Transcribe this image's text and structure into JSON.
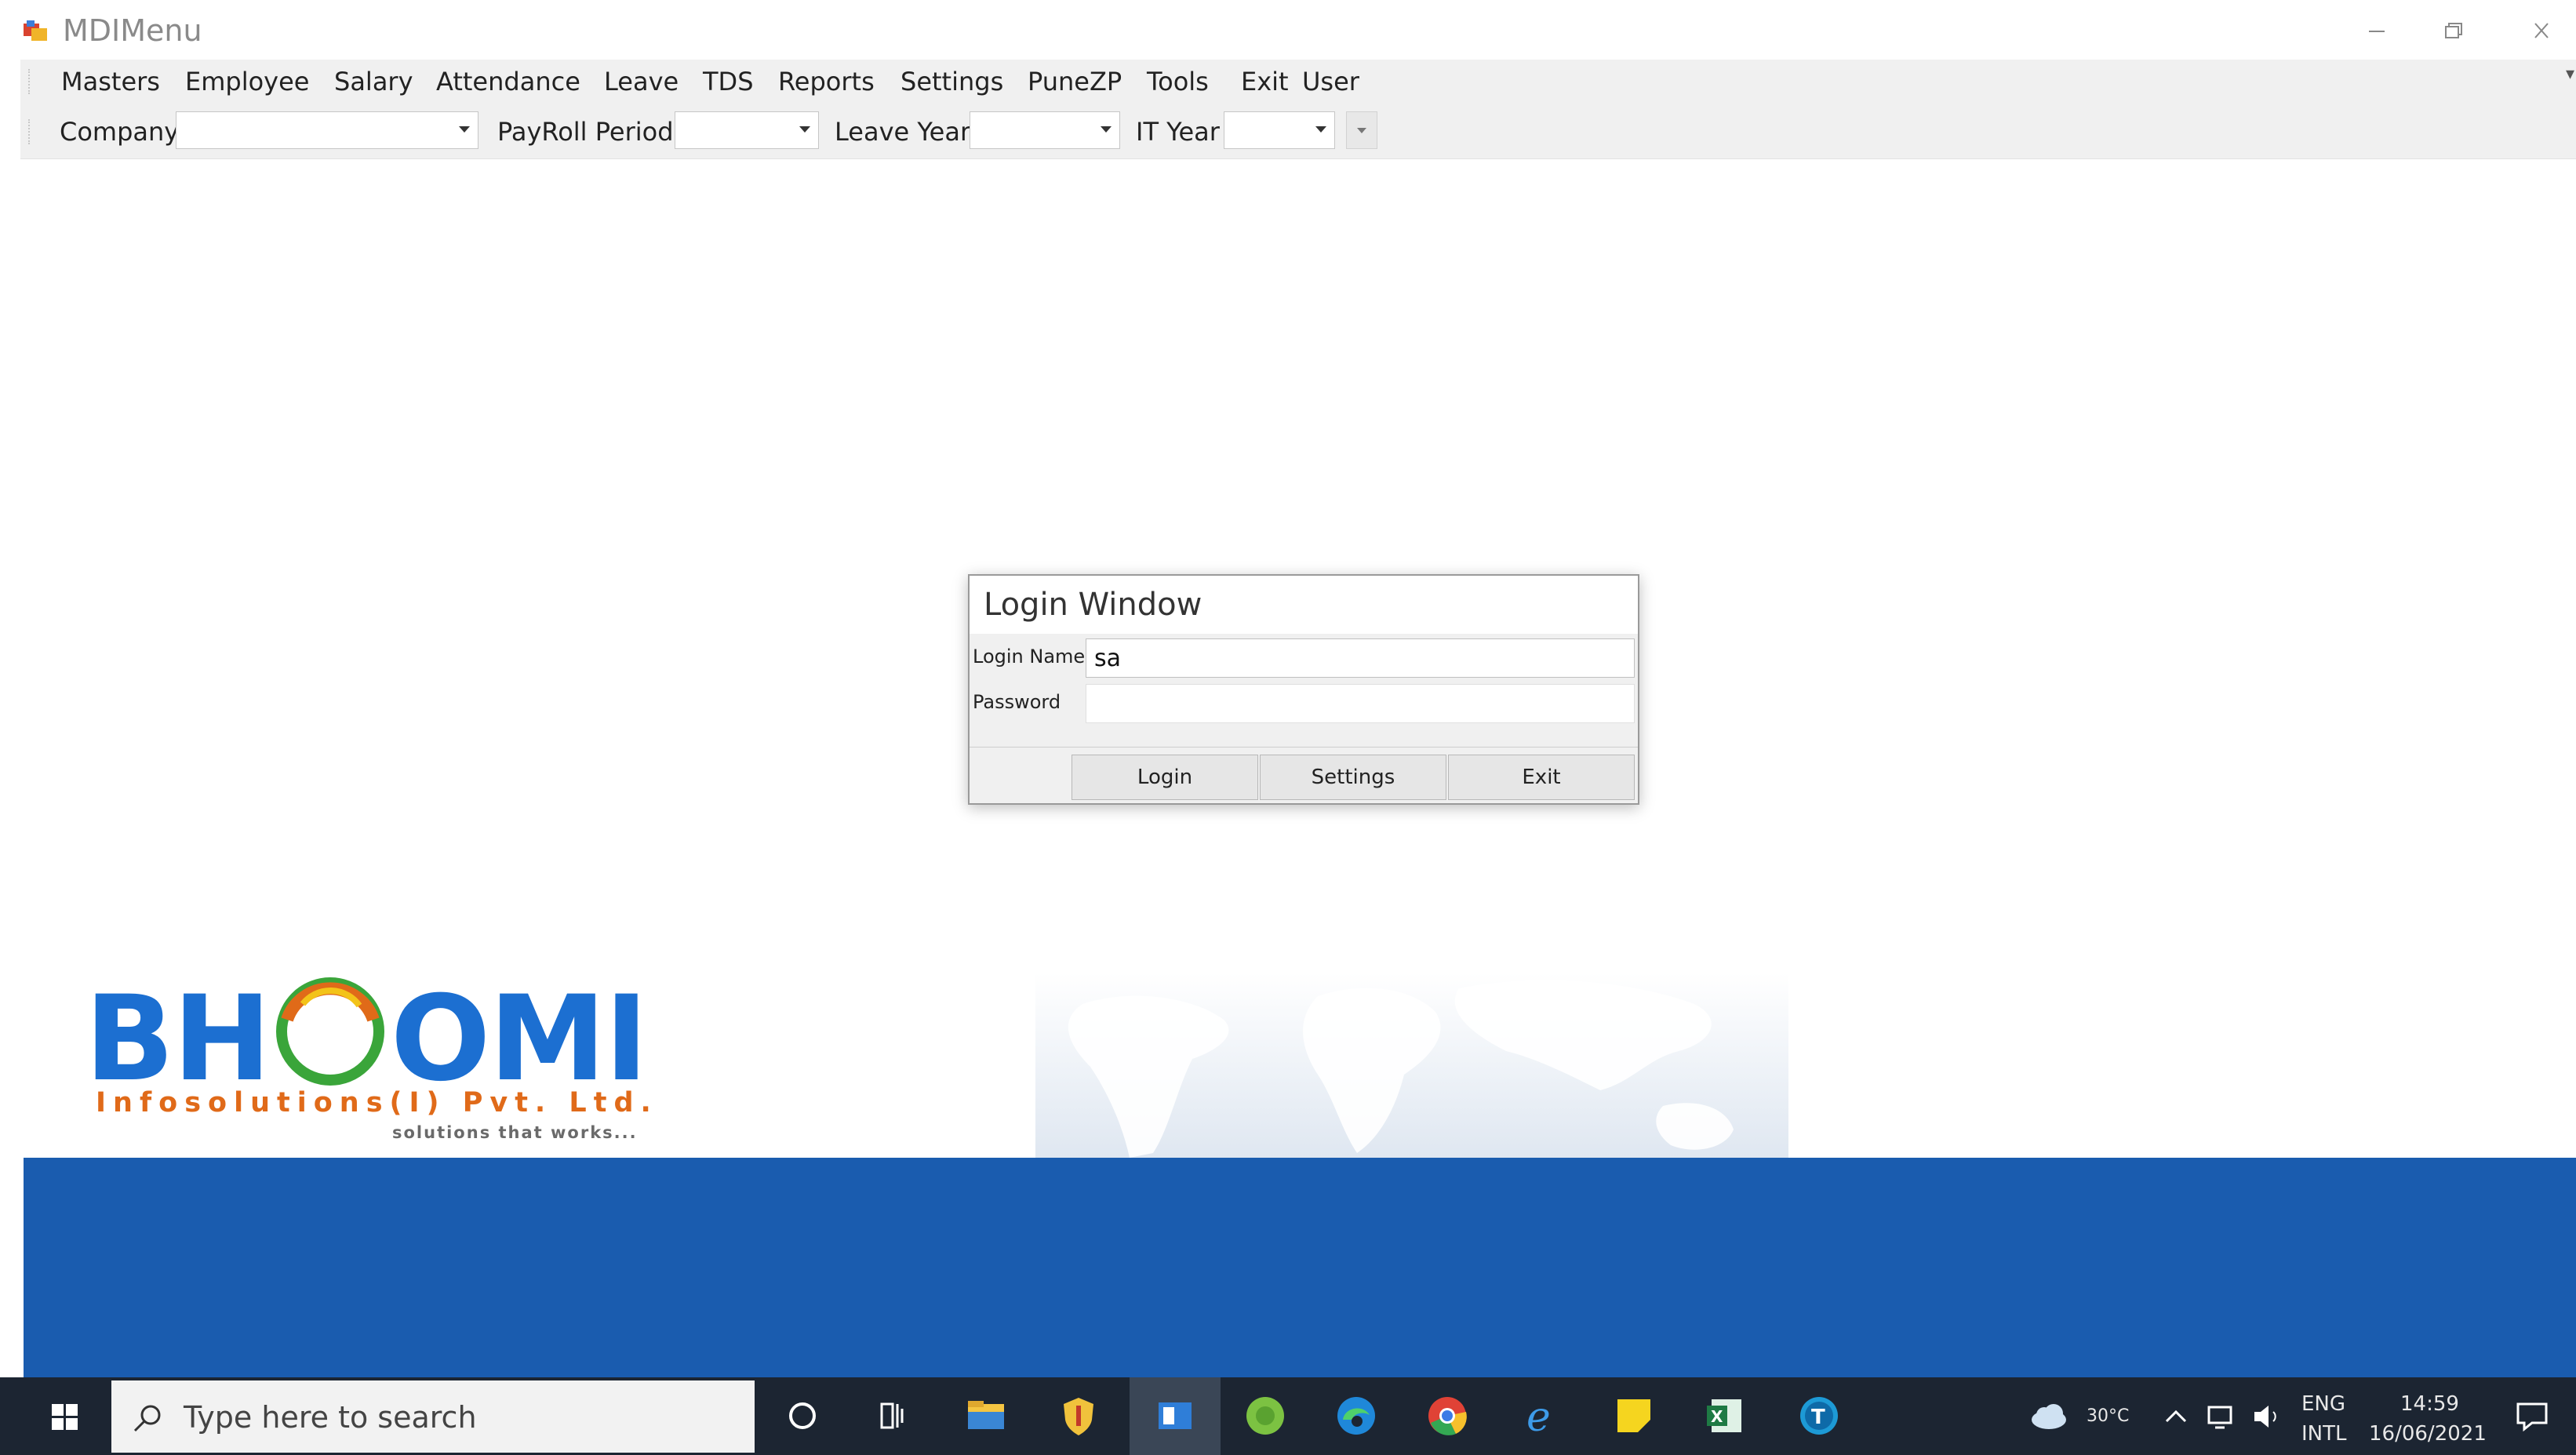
{
  "window": {
    "title": "MDIMenu"
  },
  "menu": {
    "items": [
      "Masters",
      "Employee",
      "Salary",
      "Attendance",
      "Leave",
      "TDS",
      "Reports",
      "Settings",
      "PuneZP",
      "Tools",
      "Exit",
      "User"
    ]
  },
  "toolbar": {
    "company_label": "Company",
    "company_value": "",
    "payroll_label": "PayRoll Period",
    "payroll_value": "",
    "leave_label": "Leave Year",
    "leave_value": "",
    "it_label": "IT Year",
    "it_value": ""
  },
  "login": {
    "title": "Login Window",
    "login_name_label": "Login Name",
    "login_name_value": "sa",
    "password_label": "Password",
    "password_value": "",
    "login_button": "Login",
    "settings_button": "Settings",
    "exit_button": "Exit"
  },
  "brand": {
    "name_part1": "BH",
    "name_part2": "OMI",
    "subtitle": "Infosolutions(I) Pvt. Ltd.",
    "tagline": "solutions that works...",
    "colors": {
      "blue": "#1c6fd1",
      "orange": "#e06a19",
      "green": "#3aa53a",
      "band": "#1a5caf"
    }
  },
  "taskbar": {
    "search_placeholder": "Type here to search",
    "weather": "30°C",
    "lang_top": "ENG",
    "lang_bottom": "INTL",
    "time": "14:59",
    "date": "16/06/2021",
    "icons": [
      "cortana-icon",
      "task-view-icon",
      "file-explorer-icon",
      "shield-app-icon",
      "active-app-icon",
      "green-ball-icon",
      "edge-icon",
      "chrome-icon",
      "internet-explorer-icon",
      "sticky-notes-icon",
      "excel-icon",
      "teamviewer-icon"
    ]
  }
}
